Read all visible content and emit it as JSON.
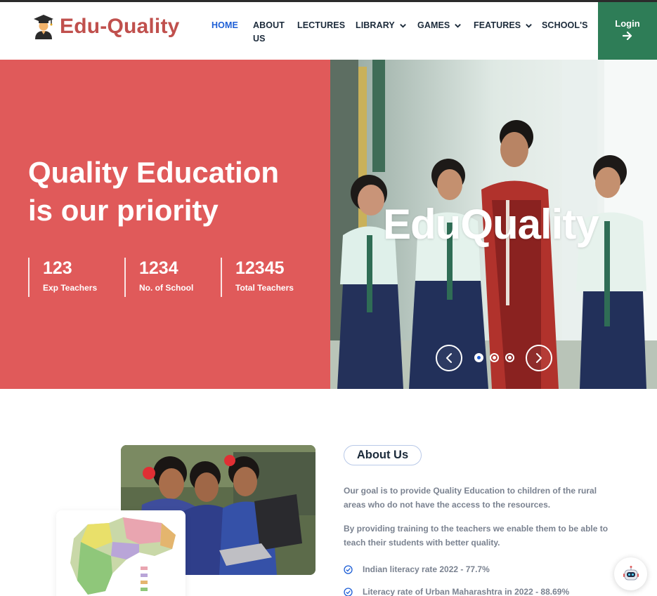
{
  "brand": {
    "name": "Edu-Quality",
    "icon": "graduate-avatar-icon"
  },
  "nav": {
    "items": [
      {
        "label": "HOME",
        "active": true
      },
      {
        "label": "ABOUT",
        "label2": "US"
      },
      {
        "label": "LECTURES"
      },
      {
        "label": "LIBRARY",
        "dropdown": true
      },
      {
        "label": "GAMES",
        "dropdown": true
      },
      {
        "label": "FEATURES",
        "dropdown": true
      },
      {
        "label": "SCHOOL'S"
      }
    ],
    "login_label": "Login"
  },
  "hero": {
    "title_line1": "Quality Education",
    "title_line2": "is our priority",
    "stats": [
      {
        "value": "123",
        "label": "Exp Teachers"
      },
      {
        "value": "1234",
        "label": "No. of School"
      },
      {
        "value": "12345",
        "label": "Total Teachers"
      }
    ],
    "slide_overlay": "EduQuality",
    "carousel": {
      "slide_count": 3,
      "active_index": 0
    }
  },
  "about": {
    "heading": "About Us",
    "para1": "Our goal is to provide Quality Education to children of the rural areas who do not have the access to the resources.",
    "para2": "By providing training to the teachers we enable them to be able to teach their students with better quality.",
    "checks": [
      "Indian literacy rate 2022 - 77.7%",
      "Literacy rate of Urban Maharashtra in 2022 - 88.69%"
    ]
  },
  "colors": {
    "hero_red": "#e05a5a",
    "brand_red": "#c0504d",
    "login_green": "#2e7d57",
    "accent_blue": "#1e5fd6",
    "text_dark": "#1b2a3a",
    "text_muted": "#7a8290"
  }
}
